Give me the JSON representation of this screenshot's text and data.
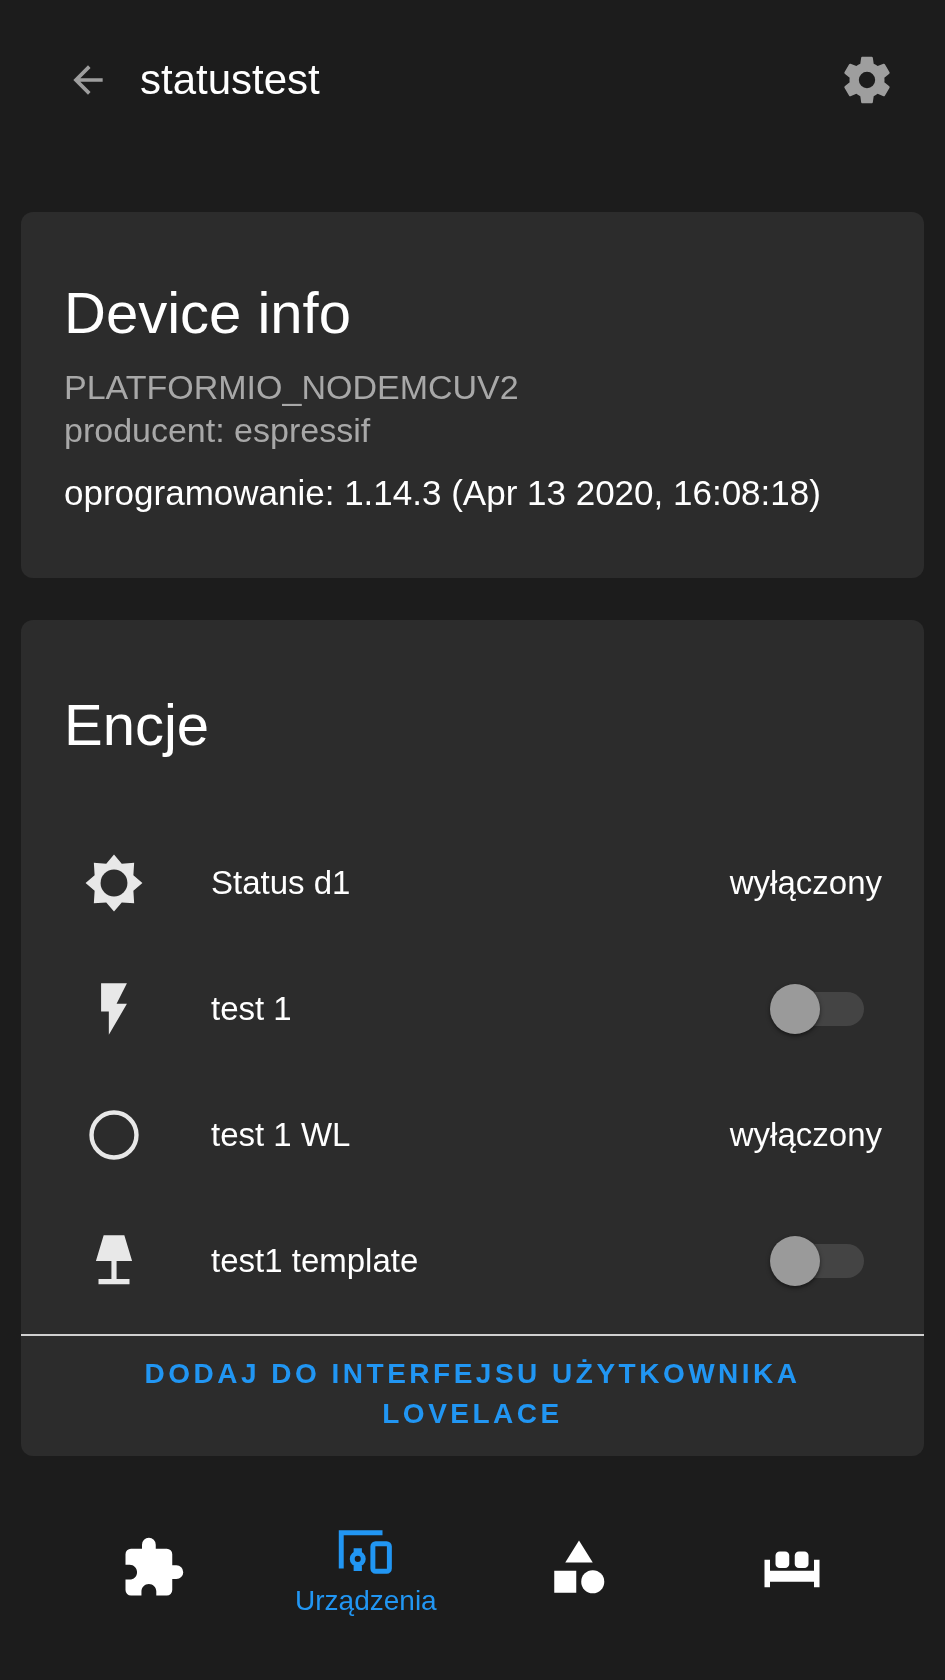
{
  "header": {
    "title": "statustest"
  },
  "device_info": {
    "title": "Device info",
    "model": "PLATFORMIO_NODEMCUV2",
    "manufacturer": "producent: espressif",
    "firmware": "oprogramowanie: 1.14.3 (Apr 13 2020, 16:08:18)"
  },
  "entities": {
    "title": "Encje",
    "rows": [
      {
        "kind": "state",
        "name": "Status d1",
        "state": "wyłączony"
      },
      {
        "kind": "toggle",
        "name": "test 1",
        "on": false
      },
      {
        "kind": "state",
        "name": "test 1 WL",
        "state": "wyłączony"
      },
      {
        "kind": "toggle",
        "name": "test1 template",
        "on": false
      }
    ],
    "action": "DODAJ DO INTERFEJSU UŻYTKOWNIKA LOVELACE"
  },
  "bottom_nav": [
    {
      "selected": false
    },
    {
      "selected": true,
      "label": "Urządzenia"
    },
    {
      "selected": false
    },
    {
      "selected": false
    }
  ]
}
